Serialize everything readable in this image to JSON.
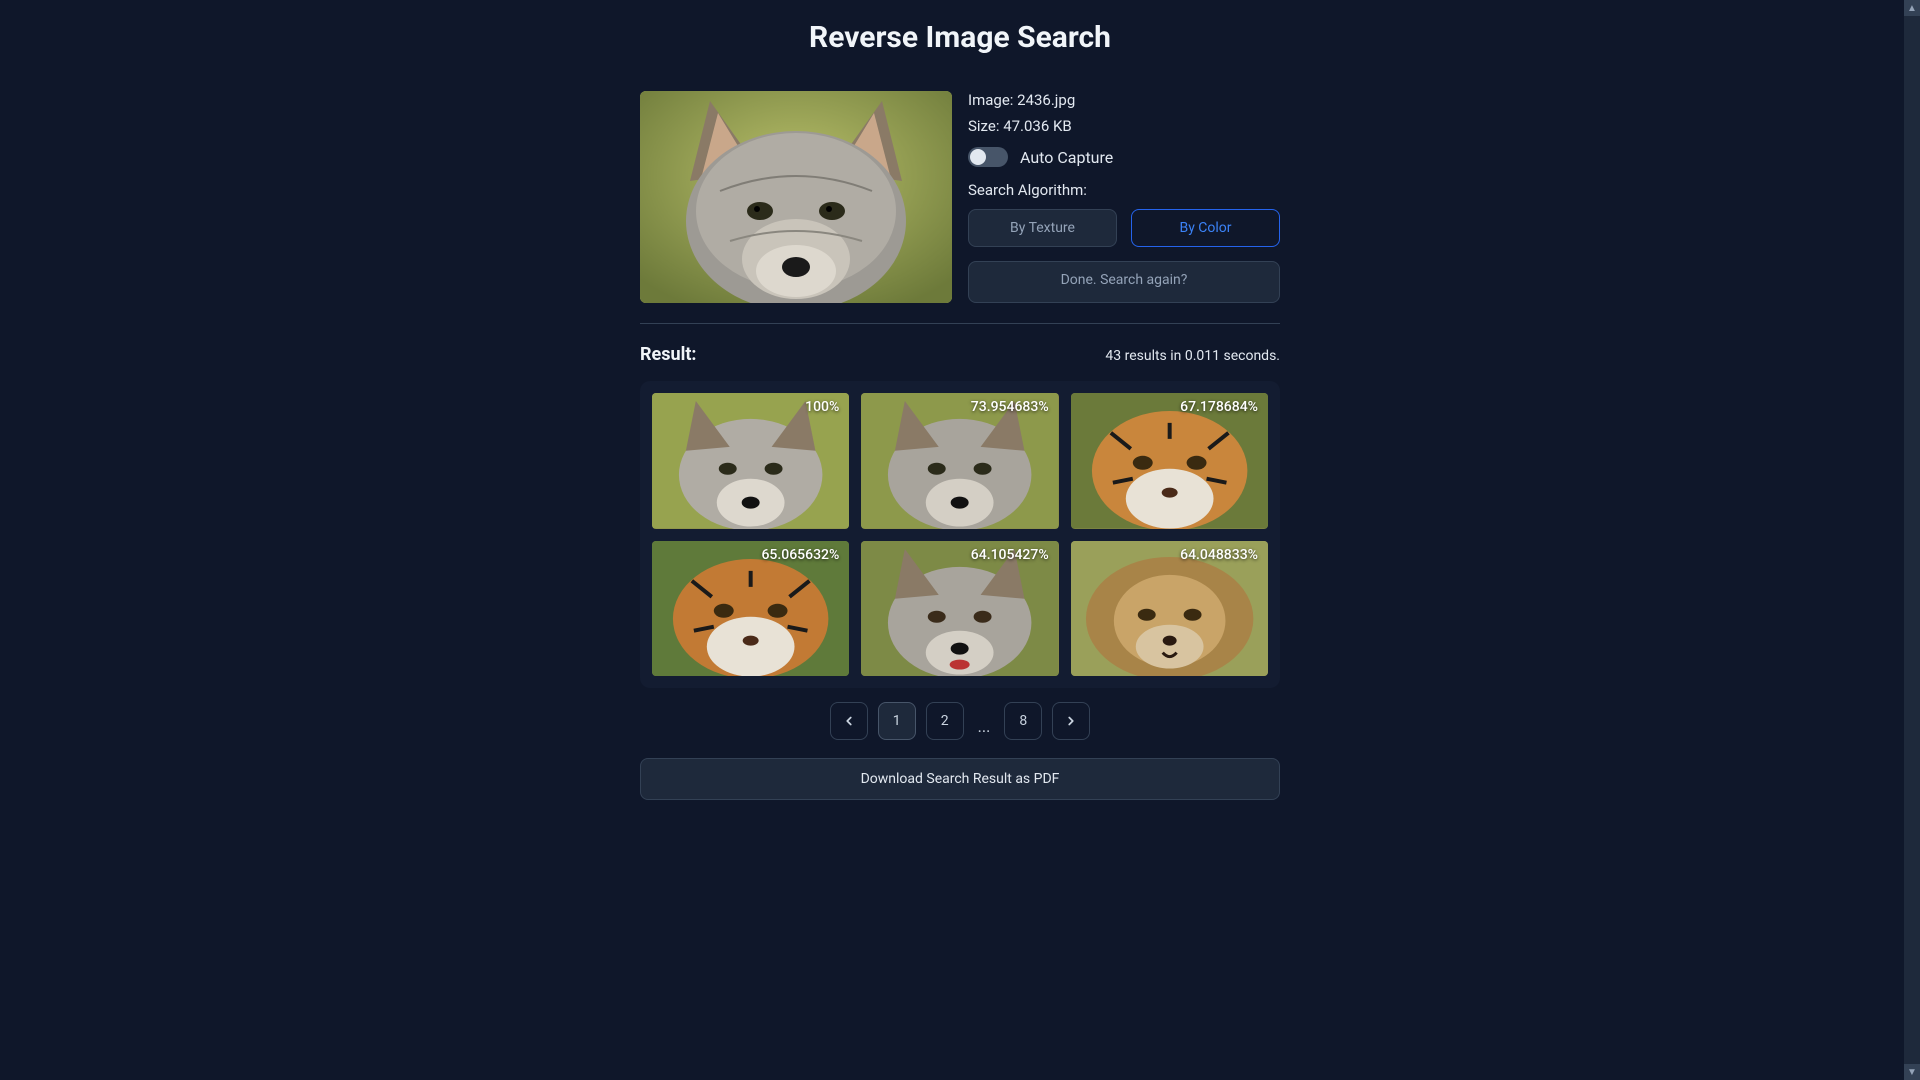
{
  "title": "Reverse Image Search",
  "meta": {
    "image_label_prefix": "Image: ",
    "image_name": "2436.jpg",
    "size_label_prefix": "Size: ",
    "size_value": "47.036 KB",
    "auto_capture_label": "Auto Capture",
    "algo_label": "Search Algorithm:",
    "by_texture_label": "By Texture",
    "by_color_label": "By Color",
    "search_again_label": "Done. Search again?"
  },
  "result": {
    "heading": "Result:",
    "stats": "43 results in 0.011 seconds."
  },
  "thumbs": [
    {
      "pct": "100%",
      "kind": "gray-fox"
    },
    {
      "pct": "73.954683%",
      "kind": "gray-fox"
    },
    {
      "pct": "67.178684%",
      "kind": "tiger"
    },
    {
      "pct": "65.065632%",
      "kind": "tiger"
    },
    {
      "pct": "64.105427%",
      "kind": "gray-fox"
    },
    {
      "pct": "64.048833%",
      "kind": "lion"
    }
  ],
  "pagination": {
    "pages": [
      "1",
      "2"
    ],
    "ellipsis": "...",
    "last": "8",
    "current": 0
  },
  "download_label": "Download Search Result as PDF"
}
